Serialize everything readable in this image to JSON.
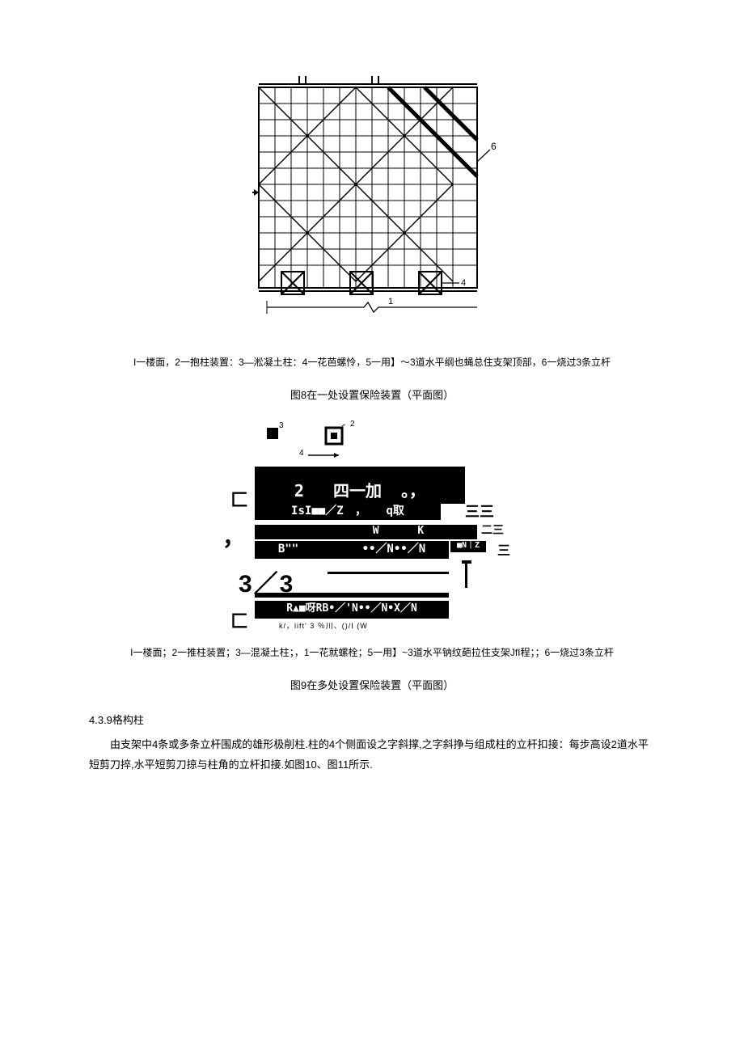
{
  "figure1": {
    "callout_1": "1",
    "callout_4": "4",
    "callout_6": "6"
  },
  "legend1": "I一楼面，2一抱柱装置：3―淞凝土柱：4一花芭螺怜，5一用】〜3道水平纲也蝇总住支架顶部，6一烧过3条立杆",
  "caption1": "图8在一处设置保险装置（平面图）",
  "figure2": {
    "label2": "2",
    "label3": "3",
    "label4": "4",
    "row1a": "2",
    "row1b": "四一加",
    "row1c": "。，",
    "row2a": "IsI■■／Z",
    "row2b": "，",
    "row2c": "q取",
    "row3a": "W",
    "row3b": "K",
    "row4pre": "■N｜Z",
    "row4a": "B\"\"",
    "row4b": "••／N••／N",
    "row5": "3／3",
    "row6": "R▲■呀RB•／'N••／N•X／N",
    "comma": "，",
    "left_bracket_top": "匚",
    "left_bracket_bottom": "匚",
    "right_sym_a": "三三",
    "right_sym_b": "二三",
    "right_sym_c": "三",
    "bottom_marks": "k/，lift' 3 ％川、()/I (W"
  },
  "legend2": "I一楼面；2一推柱装置；3―混凝土柱；，1一花就螺栓；5一用】~3道水平钠纹葩拉住支架JfI程；；6一烧过3条立杆",
  "caption2": "图9在多处设置保险装置（平面图）",
  "section_head": "4.3.9格构柱",
  "para1": "由支架中4条或多条立杆围成的雄形极削柱.柱的4个侧面设之字斜撑,之字斜挣与组成柱的立杆扣接：每步高设2道水平短剪刀捽,水平短剪刀掠与柱角的立杆扣接.如图10、图11所示."
}
